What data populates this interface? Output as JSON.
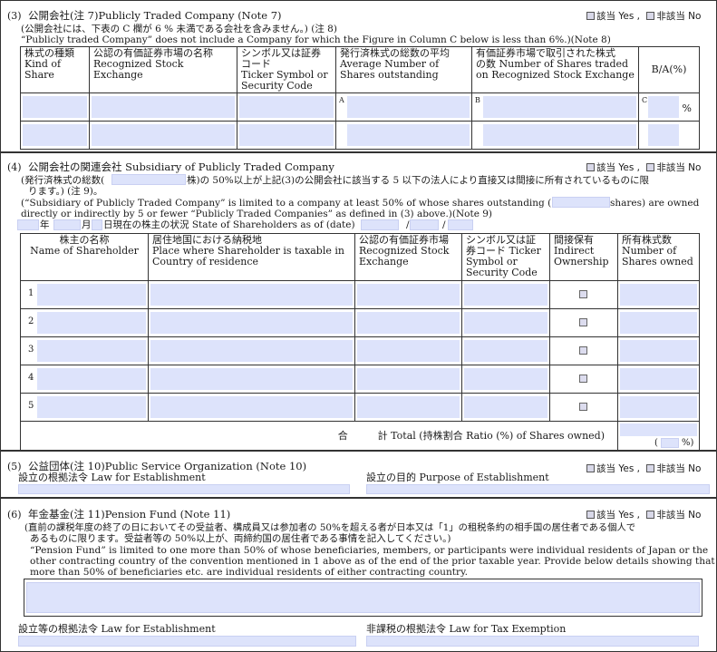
{
  "checkbox": {
    "yes": "該当 Yes",
    "no": "非該当 No",
    "sep": ","
  },
  "s3": {
    "num": "(3)",
    "title": "公開会社(注 7)Publicly Traded Company (Note 7)",
    "note_jp": "(公開会社には、下表の C 欄が 6 % 未満である会社を含みません。) (注 8)",
    "note_en": "“Publicly traded Company” does not include a Company for which the Figure in Column C below is less than 6%.)(Note 8)",
    "headers": [
      "株式の種類\nKind of\nShare",
      "公認の有価証券市場の名称\nRecognized Stock\nExchange",
      "シンボル又は証券\nコード\nTicker Symbol or\nSecurity Code",
      "発行済株式の総数の平均\nAverage Number of\nShares outstanding",
      "有価証券市場で取引された株式\nの数 Number of Shares traded\non Recognized Stock Exchange",
      "B/A(%)"
    ],
    "col_a": "A",
    "col_b": "B",
    "col_c": "C",
    "pct": "%"
  },
  "s4": {
    "num": "(4)",
    "title": "公開会社の関連会社 Subsidiary of Publicly Traded Company",
    "jp1a": "(発行済株式の総数(",
    "jp1b": "株)の 50%以上が上記(3)の公開会社に該当する 5 以下の法人により直接又は間接に所有されているものに限",
    "jp2": "ります。) (注 9)。",
    "en1a": "(“Subsidiary of Publicly Traded Company” is limited to a company at least 50% of whose shares outstanding (",
    "en1b": "shares) are owned",
    "en2": "directly or indirectly by 5 or fewer “Publicly Traded Companies” as defined in (3) above.)(Note 9)",
    "date_year": "年",
    "date_month": "月",
    "date_rest": "日現在の株主の状況 State of Shareholders as of (date)",
    "slash": "/",
    "headers": [
      "株主の名称\nName of Shareholder",
      "居住地国における納税地\nPlace where Shareholder is taxable in\nCountry of residence",
      "公認の有価証券市場\nRecognized Stock\nExchange",
      "シンボル又は証\n券コード Ticker\nSymbol or\nSecurity Code",
      "間接保有\nIndirect\nOwnership",
      "所有株式数\nNumber of\nShares owned"
    ],
    "rows": [
      "1",
      "2",
      "3",
      "4",
      "5"
    ],
    "total_label": "合　　　計 Total (持株割合 Ratio (%) of Shares owned)",
    "total_pct": "%)",
    "total_open": "("
  },
  "s5": {
    "num": "(5)",
    "title": "公益団体(注 10)Public Service Organization (Note 10)",
    "law": "設立の根拠法令 Law for Establishment",
    "purpose": "設立の目的 Purpose of Establishment"
  },
  "s6": {
    "num": "(6)",
    "title": "年金基金(注 11)Pension Fund (Note 11)",
    "jp1": "(直前の課税年度の終了の日においてその受益者、構成員又は参加者の 50%を超える者が日本又は「1」の租税条約の相手国の居住者である個人で",
    "jp2": "あるものに限ります。受益者等の 50%以上が、両締約国の居住者である事情を記入してください。)",
    "en1": "“Pension Fund” is limited to one more than 50% of whose beneficiaries, members, or participants were individual residents of Japan or the",
    "en2": "other contracting country of the convention mentioned in 1 above as of the end of the prior taxable year. Provide below details showing that",
    "en3": "more than 50% of beneficiaries etc. are individual residents of either contracting country.",
    "law": "設立等の根拠法令 Law for Establishment",
    "exempt": "非課税の根拠法令 Law for Tax Exemption"
  }
}
